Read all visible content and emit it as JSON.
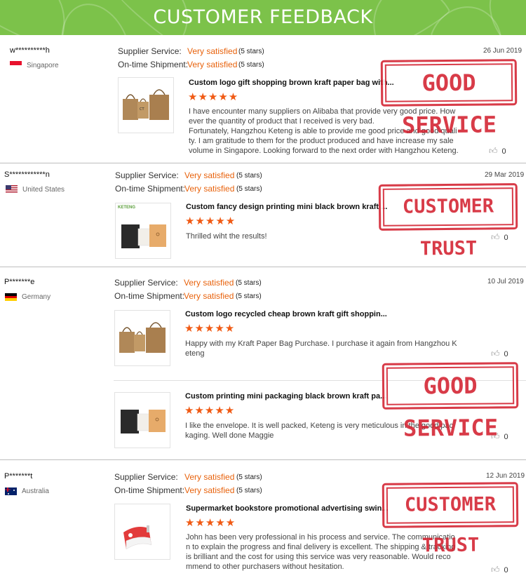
{
  "banner": {
    "title": "CUSTOMER FEEDBACK"
  },
  "labels": {
    "supplier_service": "Supplier Service:",
    "on_time_shipment": "On-time Shipment:"
  },
  "reviews": [
    {
      "user": "w**********h",
      "country": "Singapore",
      "date": "26 Jun 2019",
      "supplier_rating": "Very satisfied",
      "supplier_stars": "(5 stars)",
      "shipment_rating": "Very satisfied",
      "shipment_stars": "(5 stars)",
      "stamp": "GOOD SERVICE",
      "items": [
        {
          "title": "Custom logo gift shopping brown kraft paper bag with...",
          "stars": "★★★★★",
          "comment": "I have encounter many suppliers on Alibaba that provide very good price. However the quantity of product that I received is very bad.\nFortunately, Hangzhou Keteng is able to provide me good price and good quality. I am gratitude to them for the product produced and have increase my sale volume in Singapore. Looking forward to the next order with Hangzhou Keteng.",
          "likes": "0"
        }
      ]
    },
    {
      "user": "S************n",
      "country": "United States",
      "date": "29 Mar 2019",
      "supplier_rating": "Very satisfied",
      "supplier_stars": "(5 stars)",
      "shipment_rating": "Very satisfied",
      "shipment_stars": "(5 stars)",
      "stamp": "CUSTOMER TRUST",
      "items": [
        {
          "title": "Custom fancy design printing mini black brown kraft ...",
          "stars": "★★★★★",
          "comment": "Thrilled wiht the results!",
          "likes": "0",
          "thumb_brand": "KETENG"
        }
      ]
    },
    {
      "user": "P*******e",
      "country": "Germany",
      "date": "10 Jul 2019",
      "supplier_rating": "Very satisfied",
      "supplier_stars": "(5 stars)",
      "shipment_rating": "Very satisfied",
      "shipment_stars": "(5 stars)",
      "stamp": "GOOD SERVICE",
      "items": [
        {
          "title": "Custom logo recycled cheap brown kraft gift shoppin...",
          "stars": "★★★★★",
          "comment": "Happy with my Kraft Paper Bag Purchase. I purchase it again from Hangzhou Keteng",
          "likes": "0"
        },
        {
          "title": "Custom printing mini packaging black brown kraft pa...",
          "stars": "★★★★★",
          "comment": "I like the envelope. It is well packed, Keteng is very meticulous in the good packaging. Well done Maggie",
          "likes": "0"
        }
      ]
    },
    {
      "user": "P*******t",
      "country": "Australia",
      "date": "12 Jun 2019",
      "supplier_rating": "Very satisfied",
      "supplier_stars": "(5 stars)",
      "shipment_rating": "Very satisfied",
      "shipment_stars": "(5 stars)",
      "stamp": "CUSTOMER TRUST",
      "items": [
        {
          "title": "Supermarket bookstore promotional advertising swin...",
          "stars": "★★★★★",
          "comment": "John has been very professional in his process and service. The communication to explain the progress and final delivery is excellent. The shipping & tracking is brilliant and the cost for using this service was very reasonable. Would recommend to other purchasers without hesitation.",
          "likes": "0"
        }
      ]
    }
  ],
  "colors": {
    "banner": "#7cc24a",
    "accent": "#e8620c",
    "stars": "#f05a14",
    "stamp": "#d3212f"
  },
  "icons": {
    "like": "thumbs-up-icon"
  }
}
